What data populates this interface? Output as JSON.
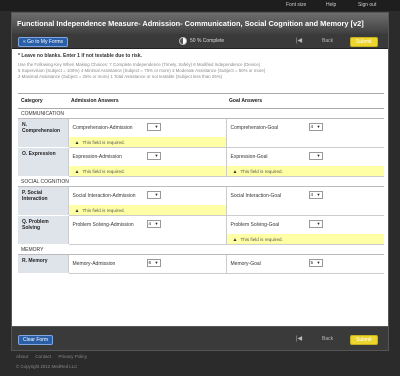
{
  "topnav": {
    "font_size": "Font size",
    "help": "Help",
    "sign_out": "Sign out"
  },
  "header": {
    "title": "Functional Independence Measure- Admission- Communication, Social Cognition and Memory [v2]"
  },
  "toolbar": {
    "go_to_forms": "« Go to My Forms",
    "progress_percent": 50,
    "progress_text": "50 % Complete",
    "back": "Back",
    "submit": "Submit"
  },
  "instructions": {
    "line1": "* Leave no blanks. Enter 1 if not testable due to risk.",
    "line2": "Use the Following Key When Making Choices: 7 Complete Independence (Timely, Safely) 6 Modified Independence (Device)",
    "line3": "5 Supervision (Subject = 100%) 4 Minimal Assistance (Subject = 75% or more) 3 Moderate Assistance (Subject = 50% or more)",
    "line4": "2 Maximal Assistance (Subject = 25% or more) 1 Total Assistance or not testable (Subject less than 25%)"
  },
  "table": {
    "headers": {
      "category": "Category",
      "admission": "Admission Answers",
      "goal": "Goal Answers"
    },
    "required_msg": "This field is required.",
    "sections": [
      {
        "title": "COMMUNICATION",
        "rows": [
          {
            "category": "N. Comprehension",
            "adm_label": "Comprehension-Admission",
            "adm_value": "",
            "adm_required": true,
            "goal_label": "Comprehension-Goal",
            "goal_value": "4",
            "goal_required": false
          },
          {
            "category": "O. Expression",
            "adm_label": "Expression-Admission",
            "adm_value": "",
            "adm_required": true,
            "goal_label": "Expression-Goal",
            "goal_value": "",
            "goal_required": true
          }
        ]
      },
      {
        "title": "SOCIAL COGNITION",
        "rows": [
          {
            "category": "P. Social Interaction",
            "adm_label": "Social Interaction-Admission",
            "adm_value": "",
            "adm_required": true,
            "goal_label": "Social Interaction-Goal",
            "goal_value": "4",
            "goal_required": false
          },
          {
            "category": "Q. Problem Solving",
            "adm_label": "Problem Solving-Admission",
            "adm_value": "4",
            "adm_required": false,
            "goal_label": "Problem Solving-Goal",
            "goal_value": "",
            "goal_required": true
          }
        ]
      },
      {
        "title": "MEMORY",
        "rows": [
          {
            "category": "R. Memory",
            "adm_label": "Memory-Admission",
            "adm_value": "6",
            "adm_required": false,
            "goal_label": "Memory-Goal",
            "goal_value": "5",
            "goal_required": false
          }
        ]
      }
    ]
  },
  "footbar": {
    "clear_form": "Clear Form",
    "back": "Back",
    "submit": "Submit"
  },
  "footer": {
    "about": "About",
    "contact": "Contact",
    "privacy": "Privacy Policy",
    "copyright": "© Copyright 2012 MedRed LLC"
  },
  "colors": {
    "accent_blue": "#2a5fa8",
    "submit_yellow": "#ecd62e",
    "required_bg": "#ffffa6",
    "category_bg": "#dfe3ea"
  },
  "icons": {
    "progress": "progress-pie-icon",
    "first_page": "first-page-icon",
    "last_page": "last-page-icon",
    "warning": "warning-icon",
    "dropdown": "chevron-down-icon"
  }
}
